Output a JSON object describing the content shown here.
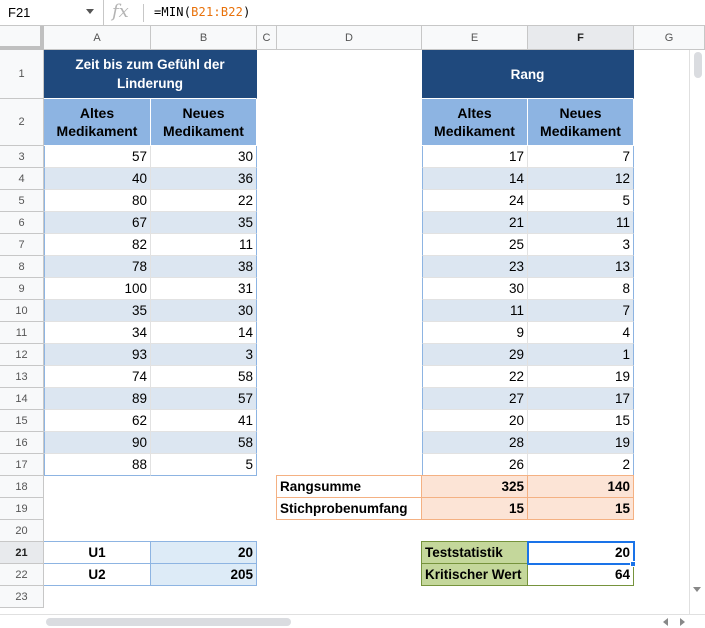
{
  "formula_bar": {
    "cell_ref": "F21",
    "fx": "fx",
    "formula_prefix": "=MIN(",
    "formula_ref": "B21:B22",
    "formula_suffix": ")"
  },
  "columns": [
    "A",
    "B",
    "C",
    "D",
    "E",
    "F",
    "G"
  ],
  "rows": [
    "1",
    "2",
    "3",
    "4",
    "5",
    "6",
    "7",
    "8",
    "9",
    "10",
    "11",
    "12",
    "13",
    "14",
    "15",
    "16",
    "17",
    "18",
    "19",
    "20",
    "21",
    "22",
    "23"
  ],
  "left_table": {
    "title": "Zeit bis zum Gefühl der Linderung",
    "col1_header": "Altes Medikament",
    "col2_header": "Neues Medikament",
    "old": [
      "57",
      "40",
      "80",
      "67",
      "82",
      "78",
      "100",
      "35",
      "34",
      "93",
      "74",
      "89",
      "62",
      "90",
      "88"
    ],
    "new": [
      "30",
      "36",
      "22",
      "35",
      "11",
      "38",
      "31",
      "30",
      "14",
      "3",
      "58",
      "57",
      "41",
      "58",
      "5"
    ]
  },
  "right_table": {
    "title": "Rang",
    "col1_header": "Altes Medikament",
    "col2_header": "Neues Medikament",
    "old": [
      "17",
      "14",
      "24",
      "21",
      "25",
      "23",
      "30",
      "11",
      "9",
      "29",
      "22",
      "27",
      "20",
      "28",
      "26"
    ],
    "new": [
      "7",
      "12",
      "5",
      "11",
      "3",
      "13",
      "8",
      "7",
      "4",
      "1",
      "19",
      "17",
      "15",
      "19",
      "2"
    ]
  },
  "summary": {
    "rank_sum_label": "Rangsumme",
    "rank_sum_old": "325",
    "rank_sum_new": "140",
    "sample_size_label": "Stichprobenumfang",
    "sample_size_old": "15",
    "sample_size_new": "15"
  },
  "u_values": {
    "u1_label": "U1",
    "u1_value": "20",
    "u2_label": "U2",
    "u2_value": "205"
  },
  "test": {
    "stat_label": "Teststatistik",
    "stat_value": "20",
    "crit_label": "Kritischer Wert",
    "crit_value": "64"
  }
}
